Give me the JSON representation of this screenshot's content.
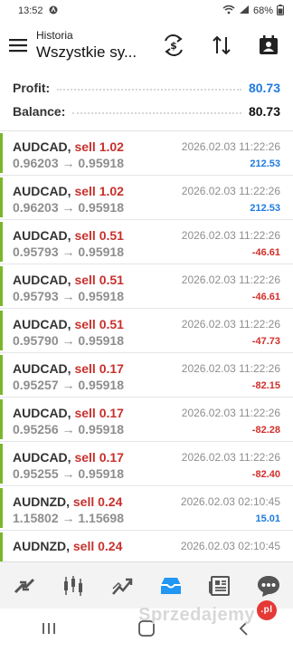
{
  "status_bar": {
    "time": "13:52",
    "battery": "68%"
  },
  "header": {
    "subtitle": "Historia",
    "title": "Wszystkie sy..."
  },
  "summary": {
    "profit_label": "Profit:",
    "profit_value": "80.73",
    "balance_label": "Balance:",
    "balance_value": "80.73"
  },
  "trades": [
    {
      "symbol": "AUDCAD,",
      "side": "sell 1.02",
      "prices": "0.96203 → 0.95918",
      "time": "2026.02.03 11:22:26",
      "profit": "212.53",
      "positive": true
    },
    {
      "symbol": "AUDCAD,",
      "side": "sell 1.02",
      "prices": "0.96203 → 0.95918",
      "time": "2026.02.03 11:22:26",
      "profit": "212.53",
      "positive": true
    },
    {
      "symbol": "AUDCAD,",
      "side": "sell 0.51",
      "prices": "0.95793 → 0.95918",
      "time": "2026.02.03 11:22:26",
      "profit": "-46.61",
      "positive": false
    },
    {
      "symbol": "AUDCAD,",
      "side": "sell 0.51",
      "prices": "0.95793 → 0.95918",
      "time": "2026.02.03 11:22:26",
      "profit": "-46.61",
      "positive": false
    },
    {
      "symbol": "AUDCAD,",
      "side": "sell 0.51",
      "prices": "0.95790 → 0.95918",
      "time": "2026.02.03 11:22:26",
      "profit": "-47.73",
      "positive": false
    },
    {
      "symbol": "AUDCAD,",
      "side": "sell 0.17",
      "prices": "0.95257 → 0.95918",
      "time": "2026.02.03 11:22:26",
      "profit": "-82.15",
      "positive": false
    },
    {
      "symbol": "AUDCAD,",
      "side": "sell 0.17",
      "prices": "0.95256 → 0.95918",
      "time": "2026.02.03 11:22:26",
      "profit": "-82.28",
      "positive": false
    },
    {
      "symbol": "AUDCAD,",
      "side": "sell 0.17",
      "prices": "0.95255 → 0.95918",
      "time": "2026.02.03 11:22:26",
      "profit": "-82.40",
      "positive": false
    },
    {
      "symbol": "AUDNZD,",
      "side": "sell 0.24",
      "prices": "1.15802 → 1.15698",
      "time": "2026.02.03 02:10:45",
      "profit": "15.01",
      "positive": true
    },
    {
      "symbol": "AUDNZD,",
      "side": "sell 0.24",
      "prices": "",
      "time": "2026.02.03 02:10:45",
      "profit": "",
      "positive": true
    }
  ],
  "colors": {
    "accent_green": "#7bb62a",
    "positive": "#1e7be0",
    "negative": "#d0302b",
    "sell": "#c8302c"
  },
  "icons": {
    "top_bar": [
      "menu-icon",
      "dollar-swap-icon",
      "sort-arrows-icon",
      "calendar-person-icon"
    ],
    "bottom_nav": [
      "quotes-icon",
      "chart-icon",
      "trade-icon",
      "history-icon",
      "news-icon",
      "messages-icon"
    ],
    "system_nav": [
      "recent-apps-icon",
      "home-icon",
      "back-icon"
    ]
  },
  "watermark": {
    "text": "Sprzedajemy",
    "badge": ".pl"
  }
}
